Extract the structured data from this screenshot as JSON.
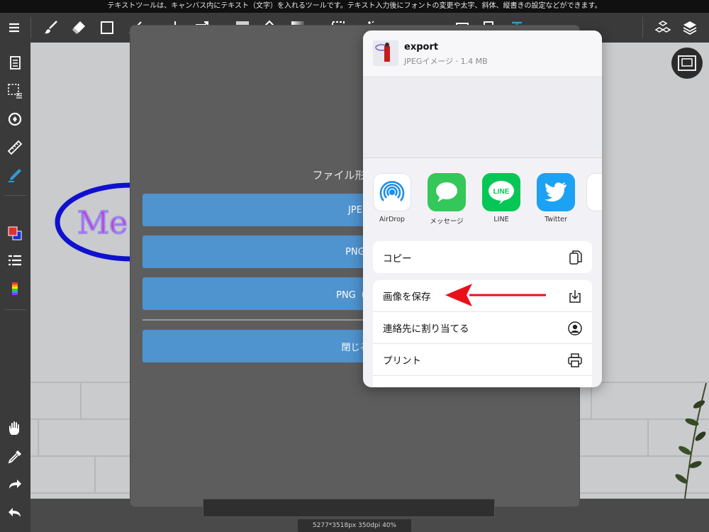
{
  "hint_bar": {
    "text": "テキストツールは、キャンバス内にテキスト（文字）を入れるツールです。テキスト入力後にフォントの変更や太字、斜体、縦書きの設定などができます。"
  },
  "toolbar": {
    "icons": [
      "menu-icon",
      "brush-icon",
      "eraser-icon",
      "rectangle-icon",
      "move-icon",
      "transform-icon",
      "fill-icon",
      "bucket-icon",
      "gradient-icon",
      "selection-icon",
      "magic-wand-icon",
      "select-pen-icon",
      "text-icon",
      "materials-icon",
      "layers-icon"
    ]
  },
  "sidebar": {
    "icons": [
      "page-icon",
      "selection-icon",
      "rotate-icon",
      "ruler-icon",
      "pen-icon",
      "color-swatch-icon",
      "layer-list-icon",
      "color-palette-icon",
      "hand-icon",
      "eyedropper-icon",
      "redo-icon",
      "undo-icon"
    ]
  },
  "canvas_art": {
    "text": "Me",
    "ellipse_color": "#1010d0",
    "text_color": "#c040d0"
  },
  "modal": {
    "title": "ファイル形式を選",
    "buttons": [
      "JPE",
      "PNG",
      "PNG（透",
      "閉じる"
    ],
    "button_color": "#4f93cf"
  },
  "status": {
    "size_text": "5277*3518px 350dpi 40%"
  },
  "share_sheet": {
    "file_name": "export",
    "file_meta": "JPEGイメージ · 1.4 MB",
    "apps": [
      {
        "label": "AirDrop",
        "icon": "airdrop-icon",
        "color": "#ffffff"
      },
      {
        "label": "メッセージ",
        "icon": "messages-icon",
        "color": "#34c759"
      },
      {
        "label": "LINE",
        "icon": "line-icon",
        "color": "#06c755",
        "icon_text": "LINE"
      },
      {
        "label": "Twitter",
        "icon": "twitter-icon",
        "color": "#1da1f2"
      }
    ],
    "actions_group1": [
      {
        "label": "コピー",
        "icon": "copy-icon"
      }
    ],
    "actions_group2": [
      {
        "label": "画像を保存",
        "icon": "save-image-icon"
      },
      {
        "label": "連絡先に割り当てる",
        "icon": "contact-icon"
      },
      {
        "label": "プリント",
        "icon": "print-icon"
      }
    ]
  },
  "annotation": {
    "arrow_color": "#e8111a"
  }
}
